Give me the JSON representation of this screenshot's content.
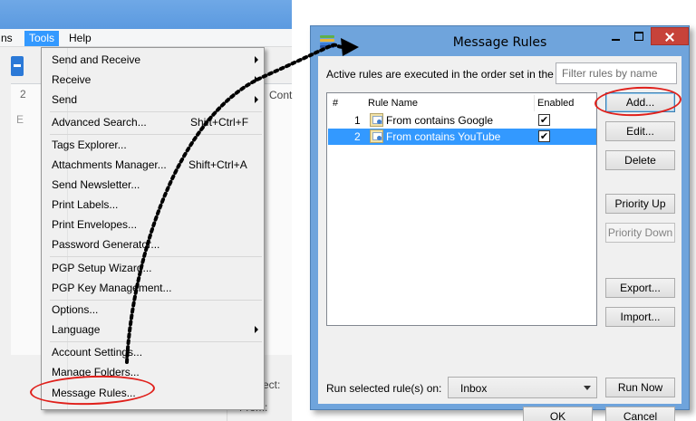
{
  "app": {
    "menubar": {
      "partial_label": "ns",
      "tools_label": "Tools",
      "help_label": "Help"
    },
    "bg_labels": {
      "cont": "Cont",
      "subject": "ect:",
      "from": "From:",
      "two": "2",
      "e": "E"
    }
  },
  "tools_menu": {
    "items": [
      {
        "label": "Send and Receive",
        "shortcut": "",
        "submenu": true
      },
      {
        "label": "Receive",
        "shortcut": "",
        "submenu": true
      },
      {
        "label": "Send",
        "shortcut": "",
        "submenu": true
      },
      {
        "label": "Advanced Search...",
        "shortcut": "Shift+Ctrl+F",
        "submenu": false
      },
      {
        "label": "Tags Explorer...",
        "shortcut": "",
        "submenu": false
      },
      {
        "label": "Attachments Manager...",
        "shortcut": "Shift+Ctrl+A",
        "submenu": false
      },
      {
        "label": "Send Newsletter...",
        "shortcut": "",
        "submenu": false
      },
      {
        "label": "Print Labels...",
        "shortcut": "",
        "submenu": false
      },
      {
        "label": "Print Envelopes...",
        "shortcut": "",
        "submenu": false
      },
      {
        "label": "Password Generator...",
        "shortcut": "",
        "submenu": false
      },
      {
        "label": "PGP Setup Wizard...",
        "shortcut": "",
        "submenu": false
      },
      {
        "label": "PGP Key Management...",
        "shortcut": "",
        "submenu": false
      },
      {
        "label": "Options...",
        "shortcut": "",
        "submenu": false
      },
      {
        "label": "Language",
        "shortcut": "",
        "submenu": true
      },
      {
        "label": "Account Settings...",
        "shortcut": "",
        "submenu": false
      },
      {
        "label": "Manage Folders...",
        "shortcut": "",
        "submenu": false
      },
      {
        "label": "Message Rules...",
        "shortcut": "",
        "submenu": false
      }
    ]
  },
  "dialog": {
    "title": "Message Rules",
    "description": "Active rules are executed in the order set in the",
    "filter_placeholder": "Filter rules by name",
    "columns": {
      "num": "#",
      "name": "Rule Name",
      "enabled": "Enabled"
    },
    "rules": [
      {
        "num": "1",
        "name": "From contains Google",
        "enabled": true,
        "selected": false
      },
      {
        "num": "2",
        "name": "From contains YouTube",
        "enabled": true,
        "selected": true
      }
    ],
    "buttons": {
      "add": "Add...",
      "edit": "Edit...",
      "delete": "Delete",
      "priority_up": "Priority Up",
      "priority_down": "Priority Down",
      "export": "Export...",
      "import": "Import...",
      "run_now": "Run Now",
      "ok": "OK",
      "cancel": "Cancel"
    },
    "run_label": "Run selected rule(s) on:",
    "run_target": "Inbox",
    "check_glyph": "✔"
  },
  "colors": {
    "accent_blue": "#3399ff",
    "annotation_red": "#e0201b",
    "dialog_frame": "#6fa4dc",
    "close_button": "#c7433a"
  }
}
